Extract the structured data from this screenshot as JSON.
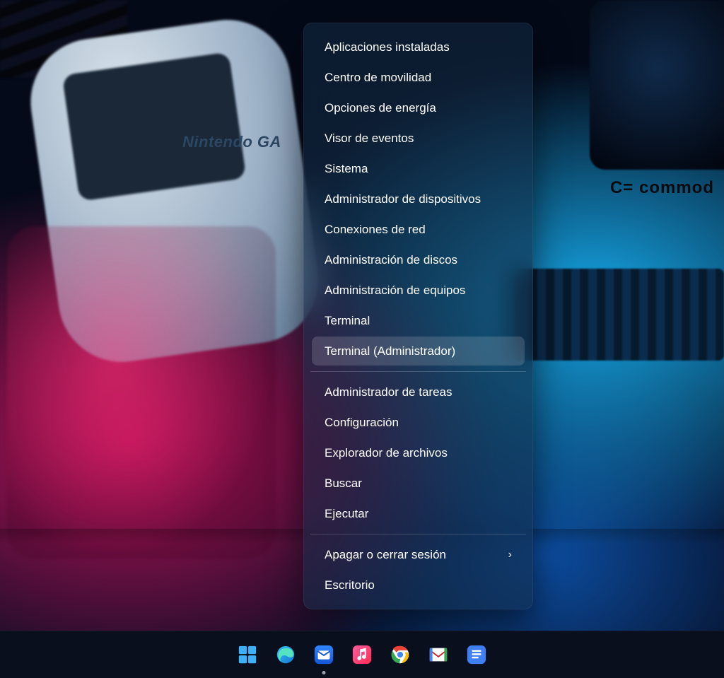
{
  "wallpaper": {
    "brand_text": "Nintendo GA",
    "logo_text": "C= commod"
  },
  "context_menu": {
    "items": [
      {
        "label": "Aplicaciones instaladas",
        "hover": false,
        "sep_after": false,
        "chevron": false
      },
      {
        "label": "Centro de movilidad",
        "hover": false,
        "sep_after": false,
        "chevron": false
      },
      {
        "label": "Opciones de energía",
        "hover": false,
        "sep_after": false,
        "chevron": false
      },
      {
        "label": "Visor de eventos",
        "hover": false,
        "sep_after": false,
        "chevron": false
      },
      {
        "label": "Sistema",
        "hover": false,
        "sep_after": false,
        "chevron": false
      },
      {
        "label": "Administrador de dispositivos",
        "hover": false,
        "sep_after": false,
        "chevron": false
      },
      {
        "label": "Conexiones de red",
        "hover": false,
        "sep_after": false,
        "chevron": false
      },
      {
        "label": "Administración de discos",
        "hover": false,
        "sep_after": false,
        "chevron": false
      },
      {
        "label": "Administración de equipos",
        "hover": false,
        "sep_after": false,
        "chevron": false
      },
      {
        "label": "Terminal",
        "hover": false,
        "sep_after": false,
        "chevron": false
      },
      {
        "label": "Terminal (Administrador)",
        "hover": true,
        "sep_after": true,
        "chevron": false
      },
      {
        "label": "Administrador de tareas",
        "hover": false,
        "sep_after": false,
        "chevron": false
      },
      {
        "label": "Configuración",
        "hover": false,
        "sep_after": false,
        "chevron": false
      },
      {
        "label": "Explorador de archivos",
        "hover": false,
        "sep_after": false,
        "chevron": false
      },
      {
        "label": "Buscar",
        "hover": false,
        "sep_after": false,
        "chevron": false
      },
      {
        "label": "Ejecutar",
        "hover": false,
        "sep_after": true,
        "chevron": false
      },
      {
        "label": "Apagar o cerrar sesión",
        "hover": false,
        "sep_after": false,
        "chevron": true
      },
      {
        "label": "Escritorio",
        "hover": false,
        "sep_after": false,
        "chevron": false
      }
    ]
  },
  "taskbar": {
    "icons": [
      {
        "name": "start-icon",
        "pinned_indicator": false
      },
      {
        "name": "edge-icon",
        "pinned_indicator": false
      },
      {
        "name": "mail-icon",
        "pinned_indicator": true
      },
      {
        "name": "music-icon",
        "pinned_indicator": false
      },
      {
        "name": "chrome-icon",
        "pinned_indicator": false
      },
      {
        "name": "gmail-icon",
        "pinned_indicator": false
      },
      {
        "name": "docs-icon",
        "pinned_indicator": false
      }
    ]
  }
}
